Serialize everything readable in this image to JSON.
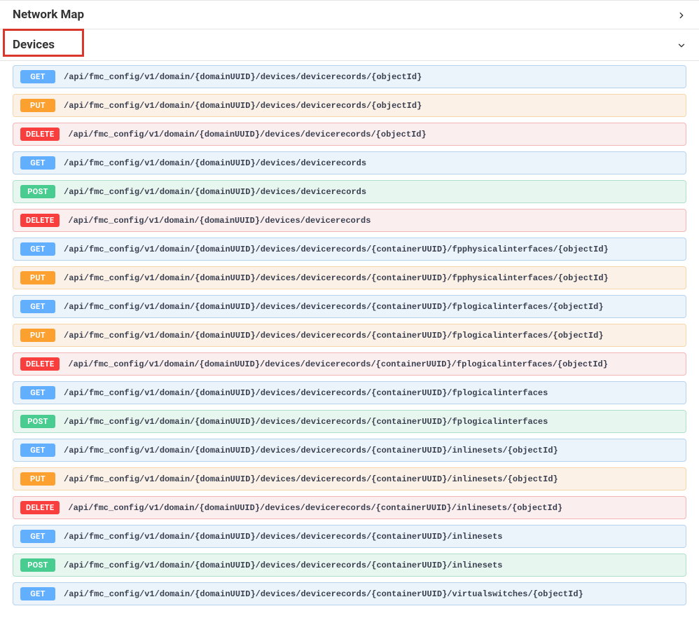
{
  "sections": {
    "network_map": {
      "title": "Network Map",
      "expanded": false
    },
    "devices": {
      "title": "Devices",
      "expanded": true
    }
  },
  "endpoints": [
    {
      "method": "GET",
      "path": "/api/fmc_config/v1/domain/{domainUUID}/devices/devicerecords/{objectId}"
    },
    {
      "method": "PUT",
      "path": "/api/fmc_config/v1/domain/{domainUUID}/devices/devicerecords/{objectId}"
    },
    {
      "method": "DELETE",
      "path": "/api/fmc_config/v1/domain/{domainUUID}/devices/devicerecords/{objectId}"
    },
    {
      "method": "GET",
      "path": "/api/fmc_config/v1/domain/{domainUUID}/devices/devicerecords"
    },
    {
      "method": "POST",
      "path": "/api/fmc_config/v1/domain/{domainUUID}/devices/devicerecords"
    },
    {
      "method": "DELETE",
      "path": "/api/fmc_config/v1/domain/{domainUUID}/devices/devicerecords"
    },
    {
      "method": "GET",
      "path": "/api/fmc_config/v1/domain/{domainUUID}/devices/devicerecords/{containerUUID}/fpphysicalinterfaces/{objectId}"
    },
    {
      "method": "PUT",
      "path": "/api/fmc_config/v1/domain/{domainUUID}/devices/devicerecords/{containerUUID}/fpphysicalinterfaces/{objectId}"
    },
    {
      "method": "GET",
      "path": "/api/fmc_config/v1/domain/{domainUUID}/devices/devicerecords/{containerUUID}/fplogicalinterfaces/{objectId}"
    },
    {
      "method": "PUT",
      "path": "/api/fmc_config/v1/domain/{domainUUID}/devices/devicerecords/{containerUUID}/fplogicalinterfaces/{objectId}"
    },
    {
      "method": "DELETE",
      "path": "/api/fmc_config/v1/domain/{domainUUID}/devices/devicerecords/{containerUUID}/fplogicalinterfaces/{objectId}"
    },
    {
      "method": "GET",
      "path": "/api/fmc_config/v1/domain/{domainUUID}/devices/devicerecords/{containerUUID}/fplogicalinterfaces"
    },
    {
      "method": "POST",
      "path": "/api/fmc_config/v1/domain/{domainUUID}/devices/devicerecords/{containerUUID}/fplogicalinterfaces"
    },
    {
      "method": "GET",
      "path": "/api/fmc_config/v1/domain/{domainUUID}/devices/devicerecords/{containerUUID}/inlinesets/{objectId}"
    },
    {
      "method": "PUT",
      "path": "/api/fmc_config/v1/domain/{domainUUID}/devices/devicerecords/{containerUUID}/inlinesets/{objectId}"
    },
    {
      "method": "DELETE",
      "path": "/api/fmc_config/v1/domain/{domainUUID}/devices/devicerecords/{containerUUID}/inlinesets/{objectId}"
    },
    {
      "method": "GET",
      "path": "/api/fmc_config/v1/domain/{domainUUID}/devices/devicerecords/{containerUUID}/inlinesets"
    },
    {
      "method": "POST",
      "path": "/api/fmc_config/v1/domain/{domainUUID}/devices/devicerecords/{containerUUID}/inlinesets"
    },
    {
      "method": "GET",
      "path": "/api/fmc_config/v1/domain/{domainUUID}/devices/devicerecords/{containerUUID}/virtualswitches/{objectId}"
    }
  ]
}
